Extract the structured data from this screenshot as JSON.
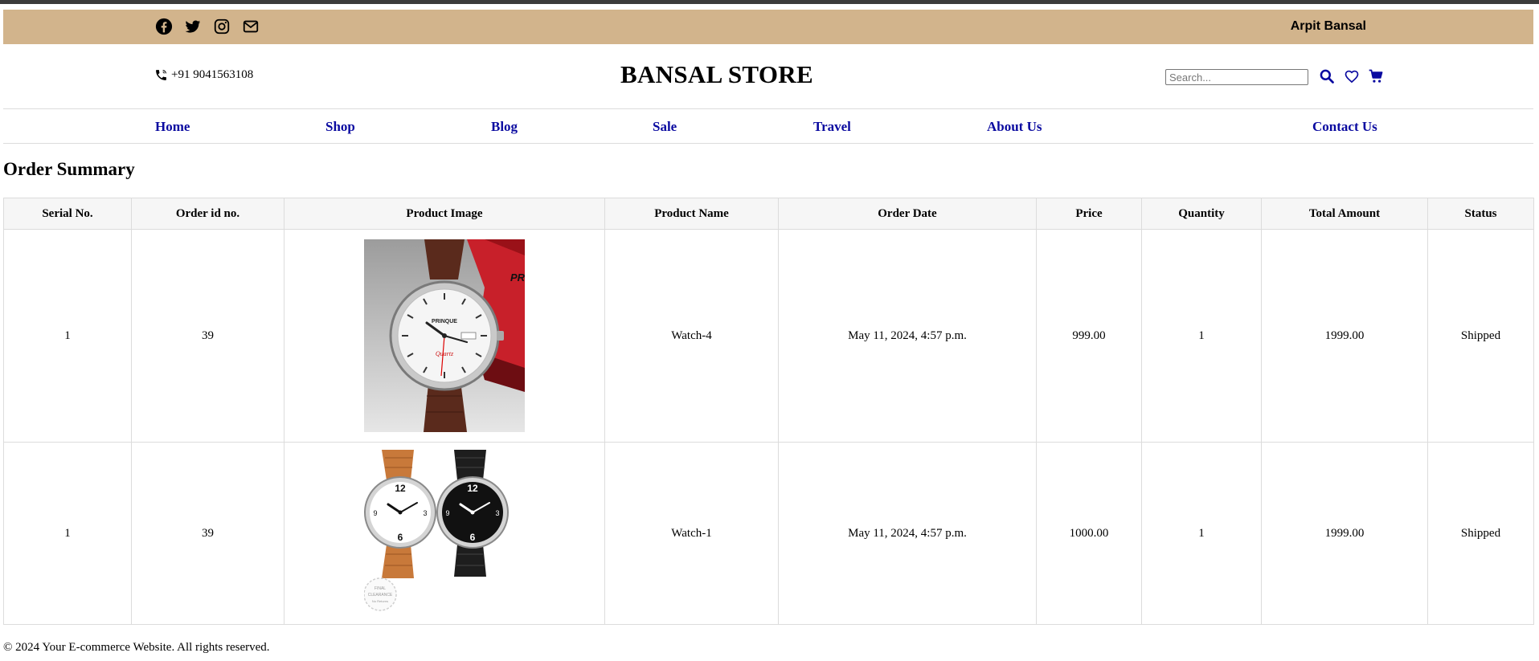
{
  "topbar": {
    "social_icons": [
      "facebook-icon",
      "twitter-icon",
      "instagram-icon",
      "envelope-icon"
    ],
    "user_name": "Arpit Bansal"
  },
  "header": {
    "phone": "+91 9041563108",
    "brand": "BANSAL STORE",
    "search_placeholder": "Search...",
    "icons": [
      "search-icon",
      "heart-icon",
      "cart-icon"
    ]
  },
  "nav": {
    "items": [
      "Home",
      "Shop",
      "Blog",
      "Sale",
      "Travel",
      "About Us",
      "Contact Us"
    ]
  },
  "page_title": "Order Summary",
  "table": {
    "headers": [
      "Serial No.",
      "Order id no.",
      "Product Image",
      "Product Name",
      "Order Date",
      "Price",
      "Quantity",
      "Total Amount",
      "Status"
    ],
    "rows": [
      {
        "serial": "1",
        "order_id": "39",
        "image": "watch-brown-leather-white-dial",
        "name": "Watch-4",
        "date": "May 11, 2024, 4:57 p.m.",
        "price": "999.00",
        "quantity": "1",
        "total": "1999.00",
        "status": "Shipped"
      },
      {
        "serial": "1",
        "order_id": "39",
        "image": "watch-pair-tan-and-black",
        "name": "Watch-1",
        "date": "May 11, 2024, 4:57 p.m.",
        "price": "1000.00",
        "quantity": "1",
        "total": "1999.00",
        "status": "Shipped"
      }
    ]
  },
  "product_image_text": {
    "watch4_brand": "PRINQUE",
    "watch4_model": "Quartz",
    "watch4_box": "PR",
    "watch1_badge": [
      "FINAL",
      "CLEARANCE",
      "No Returns"
    ]
  },
  "footer": "© 2024 Your E-commerce Website. All rights reserved."
}
